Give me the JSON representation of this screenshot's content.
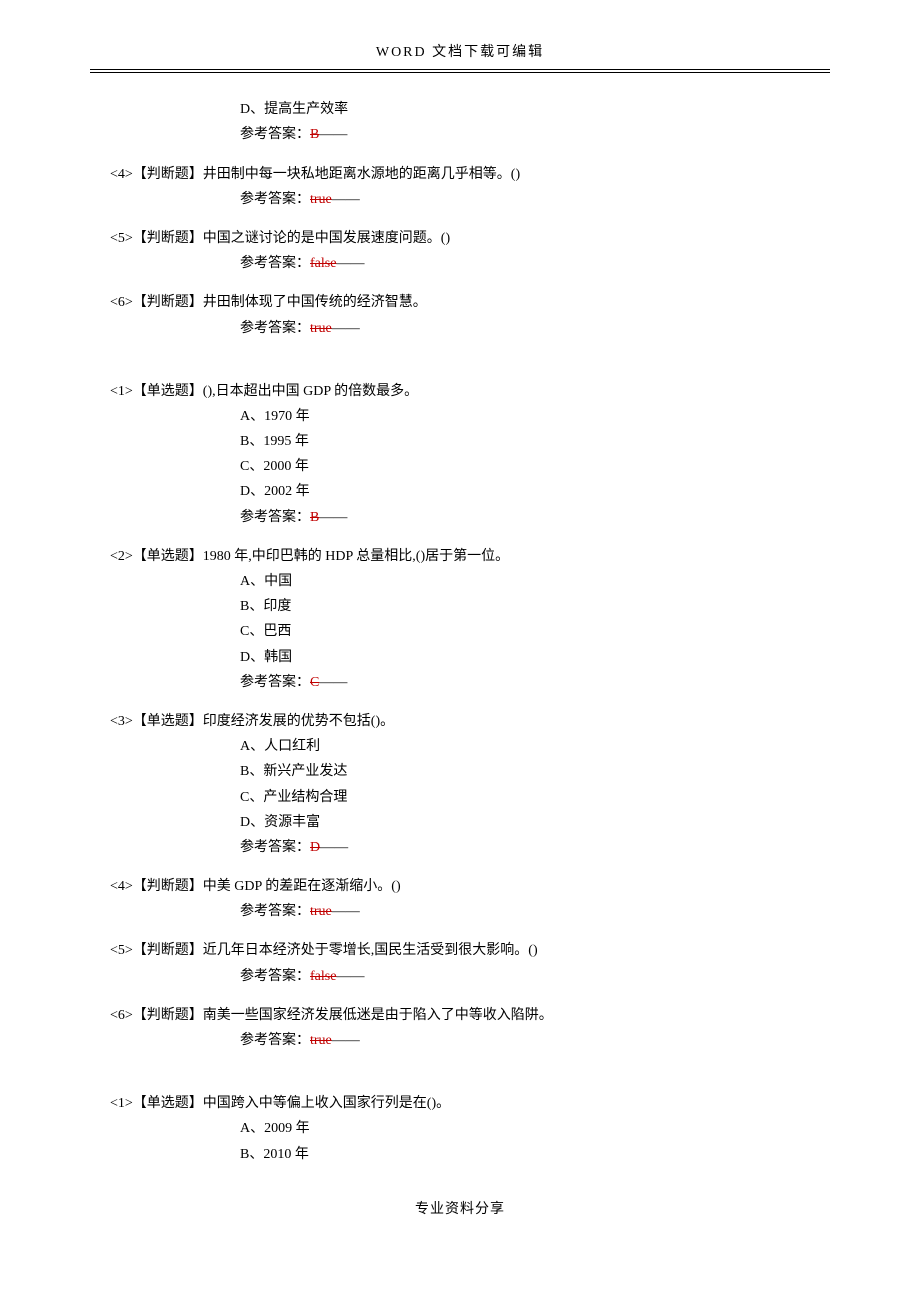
{
  "header": "WORD 文档下载可编辑",
  "footer": "专业资料分享",
  "answer_label": "参考答案：",
  "dash": "——",
  "true_text": "true",
  "false_text": "false",
  "section1": {
    "q3b": {
      "optD": "D、提高生产效率",
      "answer": "B"
    },
    "q4": {
      "text": "<4>【判断题】井田制中每一块私地距离水源地的距离几乎相等。()",
      "answer": "true"
    },
    "q5": {
      "text": "<5>【判断题】中国之谜讨论的是中国发展速度问题。()",
      "answer": "false"
    },
    "q6": {
      "text": "<6>【判断题】井田制体现了中国传统的经济智慧。",
      "answer": "true"
    }
  },
  "section2": {
    "q1": {
      "text": "<1>【单选题】(),日本超出中国 GDP 的倍数最多。",
      "optA": "A、1970 年",
      "optB": "B、1995 年",
      "optC": "C、2000 年",
      "optD": "D、2002 年",
      "answer": "B"
    },
    "q2": {
      "text": "<2>【单选题】1980 年,中印巴韩的 HDP 总量相比,()居于第一位。",
      "optA": "A、中国",
      "optB": "B、印度",
      "optC": "C、巴西",
      "optD": "D、韩国",
      "answer": "C"
    },
    "q3": {
      "text": "<3>【单选题】印度经济发展的优势不包括()。",
      "optA": "A、人口红利",
      "optB": "B、新兴产业发达",
      "optC": "C、产业结构合理",
      "optD": "D、资源丰富",
      "answer": "D"
    },
    "q4": {
      "text": "<4>【判断题】中美 GDP 的差距在逐渐缩小。()",
      "answer": "true"
    },
    "q5": {
      "text": "<5>【判断题】近几年日本经济处于零增长,国民生活受到很大影响。()",
      "answer": "false"
    },
    "q6": {
      "text": "<6>【判断题】南美一些国家经济发展低迷是由于陷入了中等收入陷阱。",
      "answer": "true"
    }
  },
  "section3": {
    "q1": {
      "text": "<1>【单选题】中国跨入中等偏上收入国家行列是在()。",
      "optA": "A、2009 年",
      "optB": "B、2010 年"
    }
  }
}
